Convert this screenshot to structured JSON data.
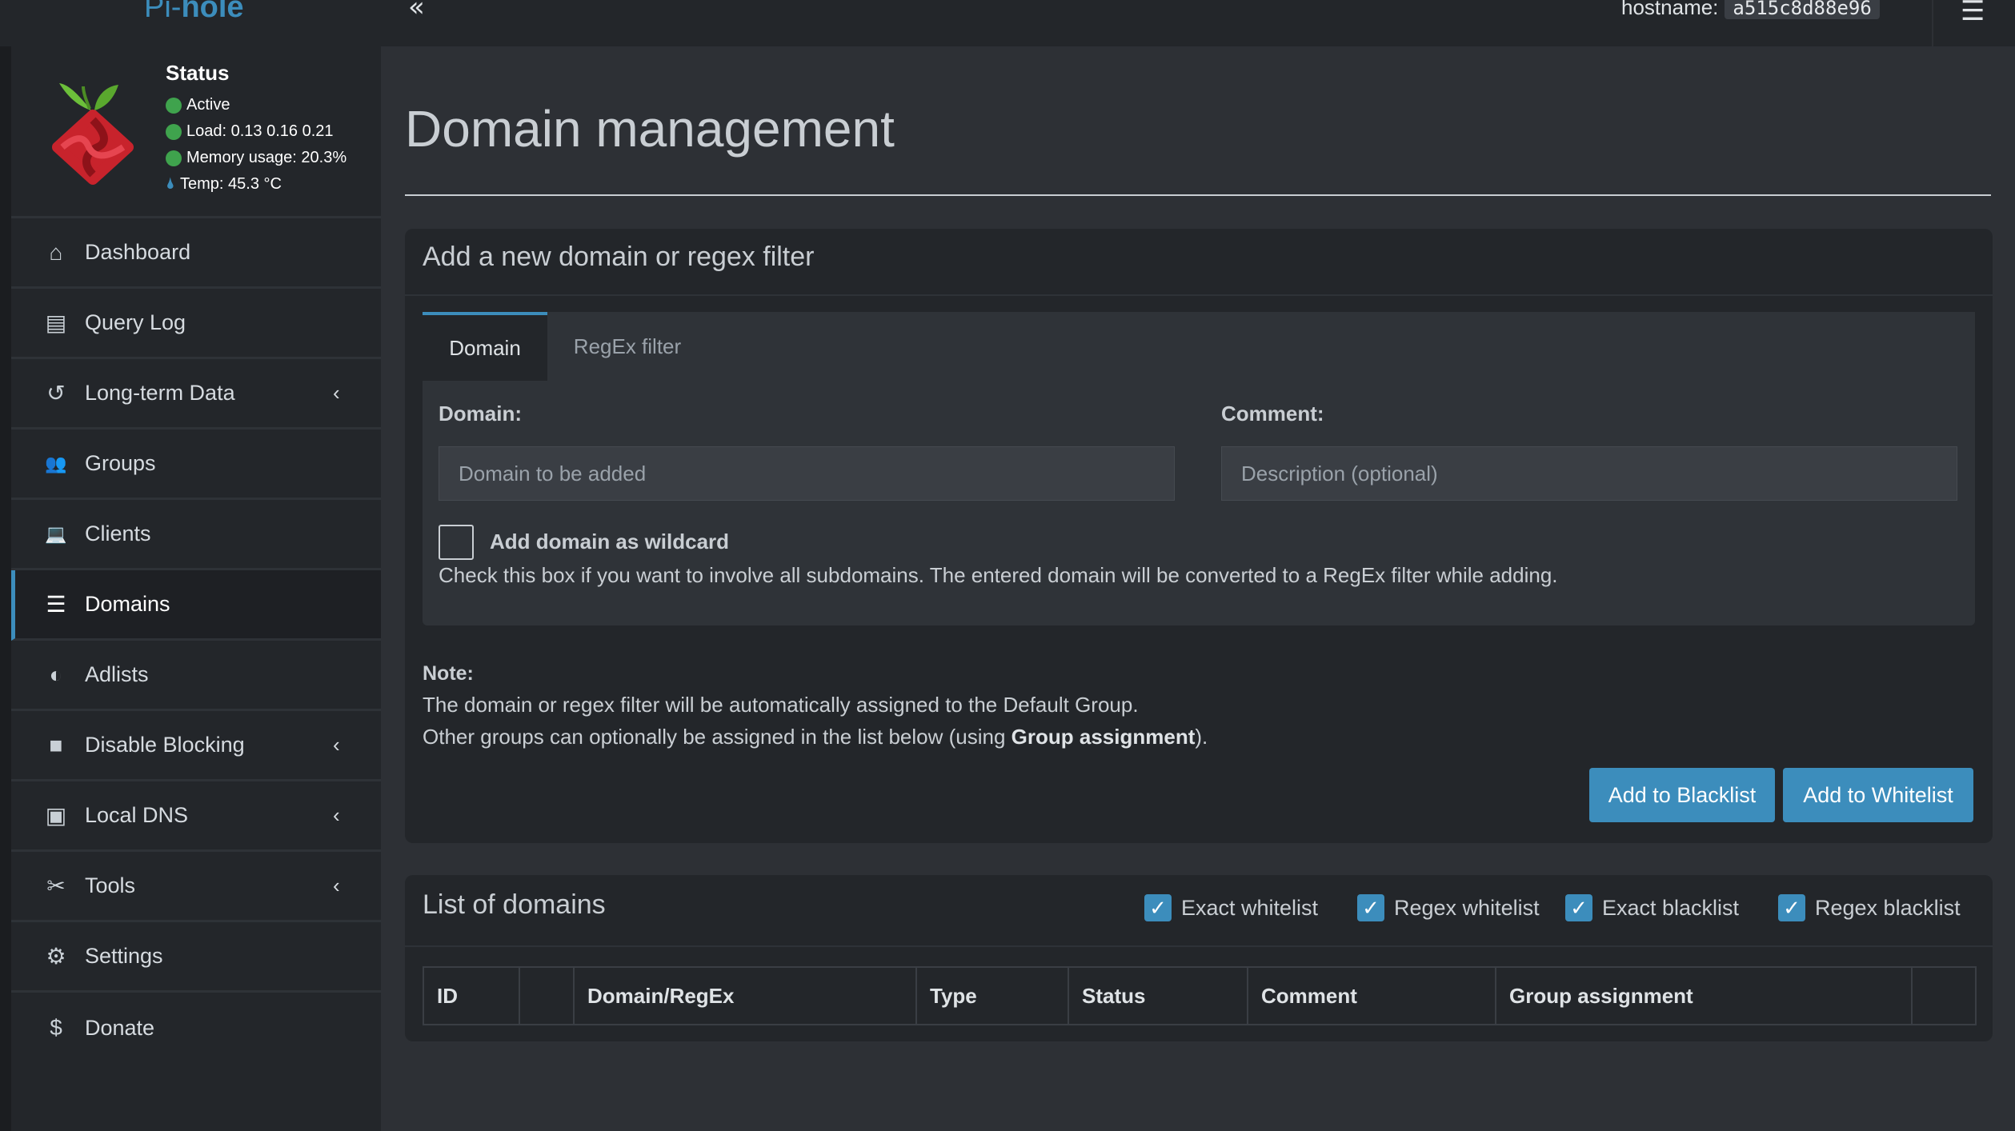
{
  "topbar": {
    "logo_prefix": "Pi-",
    "logo_suffix": "hole",
    "collapse_glyph": "«",
    "hostname_label": "hostname:",
    "hostname_value": "a515c8d88e96",
    "menu_icon": "hamburger-icon"
  },
  "status": {
    "title": "Status",
    "active": "Active",
    "load": "Load:  0.13  0.16  0.21",
    "memory": "Memory usage:  20.3%",
    "temp": "Temp: 45.3 °C"
  },
  "sidebar": {
    "items": [
      {
        "label": "Dashboard",
        "icon": "home-icon",
        "glyph": "⌂",
        "caret": ""
      },
      {
        "label": "Query Log",
        "icon": "file-icon",
        "glyph": "▤",
        "caret": ""
      },
      {
        "label": "Long-term Data",
        "icon": "history-icon",
        "glyph": "↺",
        "caret": "‹"
      },
      {
        "label": "Groups",
        "icon": "users-icon",
        "glyph": "👥",
        "caret": ""
      },
      {
        "label": "Clients",
        "icon": "laptop-icon",
        "glyph": "💻",
        "caret": ""
      },
      {
        "label": "Domains",
        "icon": "list-icon",
        "glyph": "☰",
        "caret": ""
      },
      {
        "label": "Adlists",
        "icon": "shield-icon",
        "glyph": "◐",
        "caret": ""
      },
      {
        "label": "Disable Blocking",
        "icon": "stop-icon",
        "glyph": "■",
        "caret": "‹"
      },
      {
        "label": "Local DNS",
        "icon": "address-book-icon",
        "glyph": "▣",
        "caret": "‹"
      },
      {
        "label": "Tools",
        "icon": "tools-icon",
        "glyph": "✂",
        "caret": "‹"
      },
      {
        "label": "Settings",
        "icon": "gear-icon",
        "glyph": "⚙",
        "caret": ""
      },
      {
        "label": "Donate",
        "icon": "donate-icon",
        "glyph": "$",
        "caret": ""
      }
    ]
  },
  "main": {
    "title": "Domain management",
    "add_box": {
      "header": "Add a new domain or regex filter",
      "tabs": [
        "Domain",
        "RegEx filter"
      ],
      "domain_label": "Domain:",
      "domain_placeholder": "Domain to be added",
      "comment_label": "Comment:",
      "comment_placeholder": "Description (optional)",
      "wildcard_label": "Add domain as wildcard",
      "wildcard_help": "Check this box if you want to involve all subdomains. The entered domain will be converted to a RegEx filter while adding.",
      "note_title": "Note:",
      "note_line1": "The domain or regex filter will be automatically assigned to the Default Group.",
      "note_line2_prefix": "Other groups can optionally be assigned in the list below (using ",
      "note_line2_bold": "Group assignment",
      "note_line2_suffix": ").",
      "blacklist_button": "Add to Blacklist",
      "whitelist_button": "Add to Whitelist"
    },
    "list_box": {
      "header": "List of domains",
      "filters": [
        "Exact whitelist",
        "Regex whitelist",
        "Exact blacklist",
        "Regex blacklist"
      ],
      "columns": [
        "ID",
        "",
        "Domain/RegEx",
        "Type",
        "Status",
        "Comment",
        "Group assignment",
        ""
      ]
    }
  },
  "colors": {
    "accent": "#3c8dbc",
    "status_green": "#3fa34d",
    "sidebar_bg": "#23262a",
    "content_bg": "#2d3035"
  }
}
